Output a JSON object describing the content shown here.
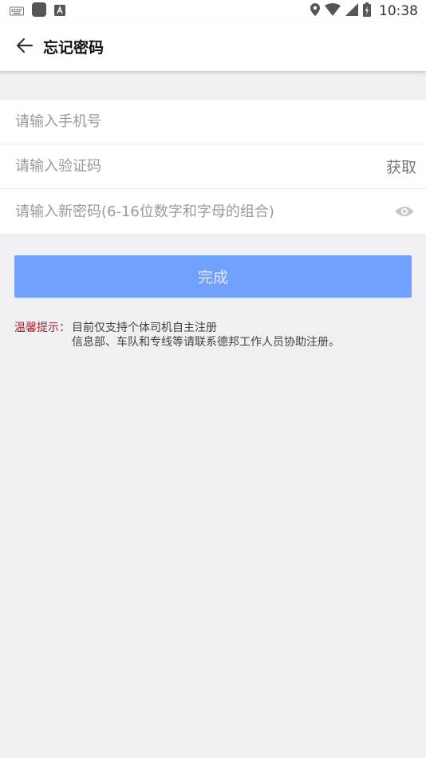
{
  "status_bar": {
    "time": "10:38",
    "icons": [
      "keyboard-icon",
      "app-notification-icon",
      "font-notification-icon",
      "location-icon",
      "wifi-icon",
      "signal-icon",
      "battery-icon"
    ]
  },
  "app_bar": {
    "title": "忘记密码",
    "back_icon": "arrow-left-icon"
  },
  "form": {
    "phone_placeholder": "请输入手机号",
    "code_placeholder": "请输入验证码",
    "get_code_label": "获取",
    "password_placeholder": "请输入新密码(6-16位数字和字母的组合)",
    "eye_icon": "eye-icon"
  },
  "submit": {
    "label": "完成"
  },
  "tips": {
    "label": "温馨提示：",
    "line1": "目前仅支持个体司机自主注册",
    "line2": "信息部、车队和专线等请联系德邦工作人员协助注册。"
  },
  "colors": {
    "background": "#efeff4",
    "primary_button": "#71a1fb",
    "tip_label": "#b1222b"
  }
}
